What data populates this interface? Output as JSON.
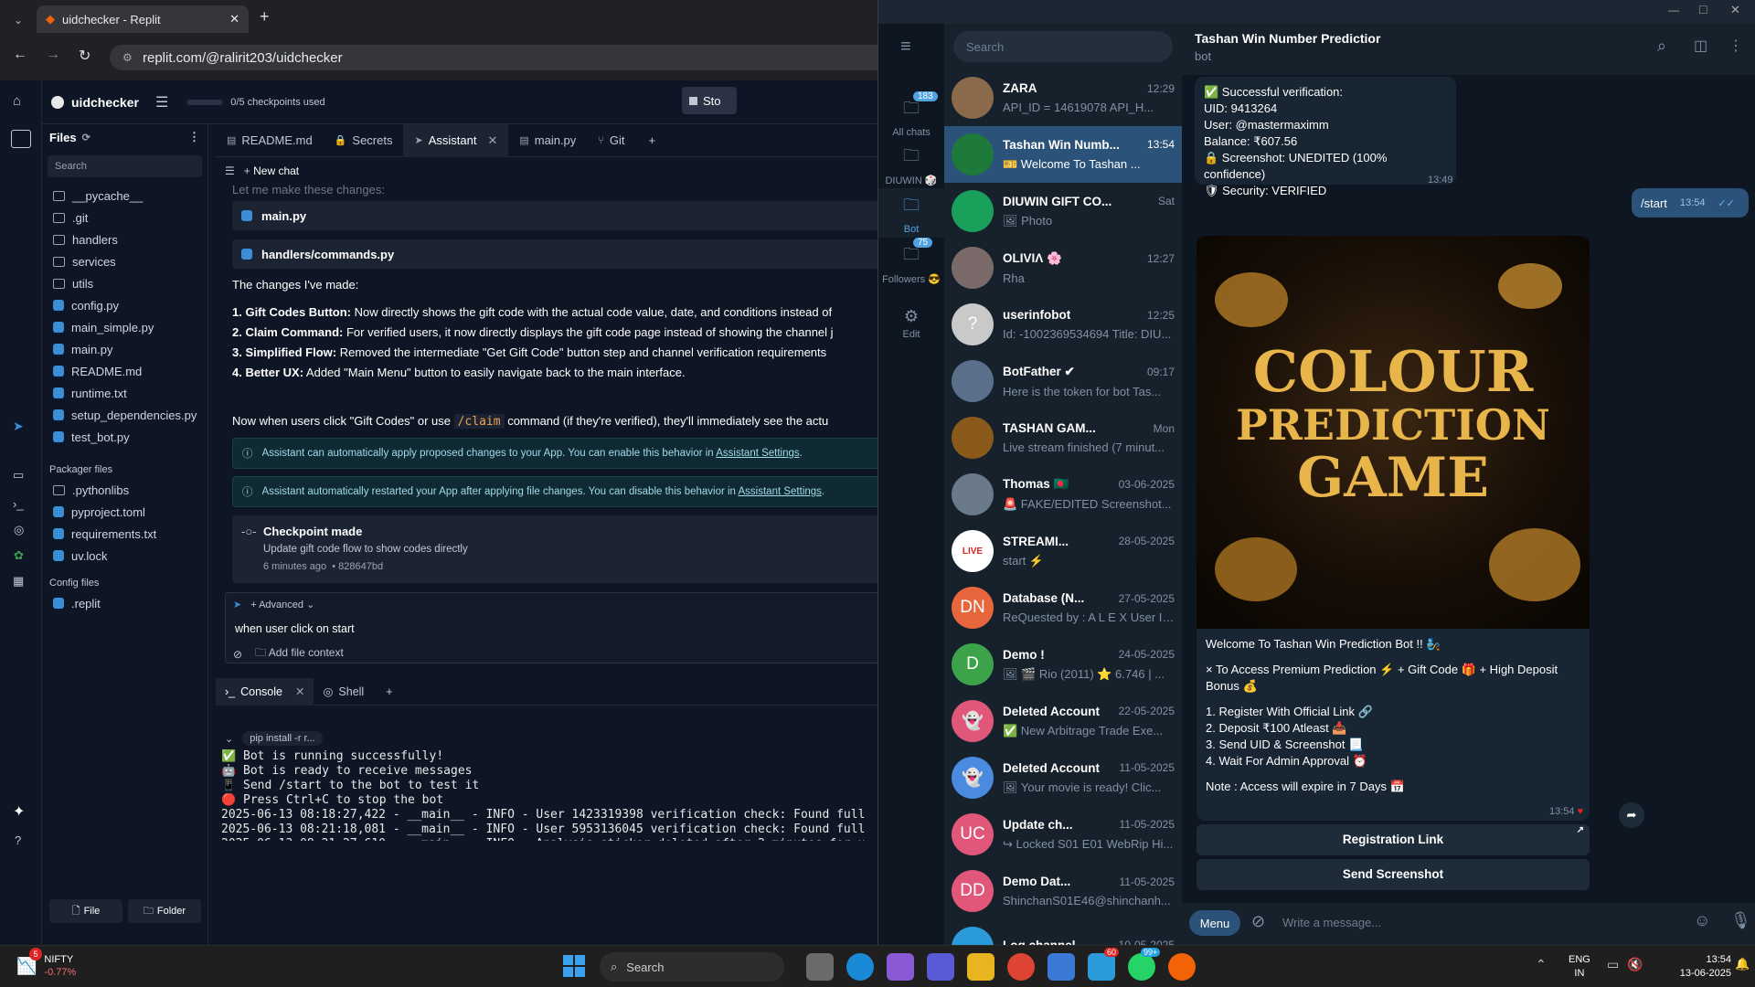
{
  "browser": {
    "tab_title": "uidchecker - Replit",
    "url": "replit.com/@ralirit203/uidchecker"
  },
  "replit": {
    "project": "uidchecker",
    "checkpoints": "0/5 checkpoints used",
    "stop_label": "Sto",
    "files_title": "Files",
    "search_placeholder": "Search",
    "files": [
      "__pycache__",
      ".git",
      "handlers",
      "services",
      "utils",
      "config.py",
      "main_simple.py",
      "main.py",
      "README.md",
      "runtime.txt",
      "setup_dependencies.py",
      "test_bot.py"
    ],
    "packager_title": "Packager files",
    "packager": [
      ".pythonlibs",
      "pyproject.toml",
      "requirements.txt",
      "uv.lock"
    ],
    "config_title": "Config files",
    "config": [
      ".replit"
    ],
    "file_btn": "File",
    "folder_btn": "Folder",
    "tabs": [
      "README.md",
      "Secrets",
      "Assistant",
      "main.py",
      "Git"
    ],
    "new_chat": "New chat",
    "faded_line": "Let me make these changes:",
    "file_cards": [
      "main.py",
      "handlers/commands.py"
    ],
    "changes_heading": "The changes I've made:",
    "changes": [
      {
        "b": "1. Gift Codes Button:",
        "t": " Now directly shows the gift code with the actual code value, date, and conditions instead of"
      },
      {
        "b": "2. Claim Command:",
        "t": " For verified users, it now directly displays the gift code page instead of showing the channel j"
      },
      {
        "b": "3. Simplified Flow:",
        "t": " Removed the intermediate \"Get Gift Code\" button step and channel verification requirements"
      },
      {
        "b": "4. Better UX:",
        "t": " Added \"Main Menu\" button to easily navigate back to the main interface."
      }
    ],
    "now_pre": "Now when users click \"Gift Codes\" or use ",
    "now_code": "/claim",
    "now_post": " command (if they're verified), they'll immediately see the actu",
    "info1": "Assistant can automatically apply proposed changes to your App. You can enable this behavior in ",
    "info2": "Assistant automatically restarted your App after applying file changes. You can disable this behavior in ",
    "info_link": "Assistant Settings",
    "checkpoint_title": "Checkpoint made",
    "checkpoint_desc": "Update gift code flow to show codes directly",
    "checkpoint_time": "6 minutes ago",
    "checkpoint_hash": "• 828647bd",
    "advanced": "Advanced",
    "input_text": "when user click on start",
    "add_context": "Add file context",
    "console_tab": "Console",
    "shell_tab": "Shell",
    "pip_chip": "pip install -r r...",
    "console_lines": [
      "✅ Bot is running successfully!",
      "🤖 Bot is ready to receive messages",
      "📱 Send /start to the bot to test it",
      "🔴 Press Ctrl+C to stop the bot",
      "2025-06-13 08:18:27,422 - __main__ - INFO - User 1423319398 verification check: Found full",
      "2025-06-13 08:21:18,081 - __main__ - INFO - User 5953136045 verification check: Found full",
      "2025-06-13 08:21:27,610 - __main__ - INFO - Analysis sticker deleted after 2 minutes for u"
    ]
  },
  "telegram": {
    "folders": [
      {
        "label": "All chats",
        "badge": "183"
      },
      {
        "label": "DIUWIN 🎲",
        "badge": ""
      },
      {
        "label": "Bot",
        "badge": ""
      },
      {
        "label": "Followers 😎",
        "badge": "75"
      },
      {
        "label": "Edit",
        "badge": ""
      }
    ],
    "search_placeholder": "Search",
    "chats": [
      {
        "name": "ZARA",
        "time": "12:29",
        "preview": "API_ID = 14619078 API_H...",
        "initials": "",
        "color": "#8a6a4a"
      },
      {
        "name": "Tashan Win Numb...",
        "time": "13:54",
        "preview": "🎫 Welcome To Tashan ...",
        "initials": "",
        "color": "#1e7a3a"
      },
      {
        "name": "DIUWIN GIFT CO...",
        "time": "Sat",
        "preview": "🖼 Photo",
        "initials": "",
        "color": "#19a05a"
      },
      {
        "name": "OLIVIΛ 🌸",
        "time": "12:27",
        "preview": "Rha",
        "initials": "",
        "color": "#7a6a6a"
      },
      {
        "name": "userinfobot",
        "time": "12:25",
        "preview": "Id: -1002369534694 Title: DIU...",
        "initials": "?",
        "color": "#c9c9c9"
      },
      {
        "name": "BotFather ✔",
        "time": "09:17",
        "preview": "Here is the token for bot Tas...",
        "initials": "",
        "color": "#5a6f8a"
      },
      {
        "name": "TASHAN GAM...",
        "time": "Mon",
        "preview": "Live stream finished (7 minut...",
        "initials": "",
        "color": "#8a5a1a"
      },
      {
        "name": "Thomas 🇧🇩",
        "time": "03-06-2025",
        "preview": "🚨 FAKE/EDITED Screenshot...",
        "initials": "",
        "color": "#6a7a8a"
      },
      {
        "name": "STREAMI...",
        "time": "28-05-2025",
        "preview": "start ⚡",
        "initials": "LIVE",
        "color": "#e02424"
      },
      {
        "name": "Database (N...",
        "time": "27-05-2025",
        "preview": "ReQuested by : A L E X User ID :...",
        "initials": "DN",
        "color": "#e8663c"
      },
      {
        "name": "Demo !",
        "time": "24-05-2025",
        "preview": "🖼 🎬 Rio (2011) ⭐ 6.746 | ...",
        "initials": "D",
        "color": "#3ca34a"
      },
      {
        "name": "Deleted Account",
        "time": "22-05-2025",
        "preview": "✅ New Arbitrage Trade Exe...",
        "initials": "👻",
        "color": "#e0577a"
      },
      {
        "name": "Deleted Account",
        "time": "11-05-2025",
        "preview": "🖼 Your movie is ready! Clic...",
        "initials": "👻",
        "color": "#4a8ae0"
      },
      {
        "name": "Update ch...",
        "time": "11-05-2025",
        "preview": "↪ Locked S01 E01 WebRip Hi...",
        "initials": "UC",
        "color": "#e0577a"
      },
      {
        "name": "Demo Dat...",
        "time": "11-05-2025",
        "preview": "ShinchanS01E46@shinchanh...",
        "initials": "DD",
        "color": "#e0577a"
      },
      {
        "name": "Log channel",
        "time": "10-05-2025",
        "preview": "",
        "initials": "",
        "color": "#2a9ad8"
      }
    ],
    "header_title": "Tashan Win Number Predictior",
    "header_sub": "bot",
    "verify_lines": [
      "✅ Successful verification:",
      "UID: 9413264",
      "User: @mastermaximm",
      "Balance: ₹607.56",
      "🔒 Screenshot: UNEDITED (100% confidence)",
      "🛡 Security: VERIFIED"
    ],
    "verify_time": "13:49",
    "out_msg": "/start",
    "out_time": "13:54",
    "poster": [
      "COLOUR",
      "PREDICTION",
      "GAME"
    ],
    "caption_lines": [
      "Welcome To Tashan Win Prediction Bot !! 🧞",
      "",
      "× To Access Premium Prediction ⚡ + Gift Code 🎁 + High Deposit Bonus 💰",
      "",
      "1. Register With Official Link 🔗",
      "2. Deposit ₹100 Atleast 📥",
      "3. Send UID & Screenshot 📃",
      "4. Wait For Admin Approval ⏰",
      "",
      "Note : Access will expire in 7 Days 📅"
    ],
    "caption_time": "13:54",
    "buttons": [
      "Registration Link",
      "Send Screenshot"
    ],
    "menu": "Menu",
    "input_placeholder": "Write a message..."
  },
  "taskbar": {
    "stock_name": "NIFTY",
    "stock_change": "-0.77%",
    "search": "Search",
    "lang": "ENG",
    "region": "IN",
    "time": "13:54",
    "date": "13-06-2025",
    "badge1": "5",
    "badge2": "99+",
    "badge3": "60"
  }
}
